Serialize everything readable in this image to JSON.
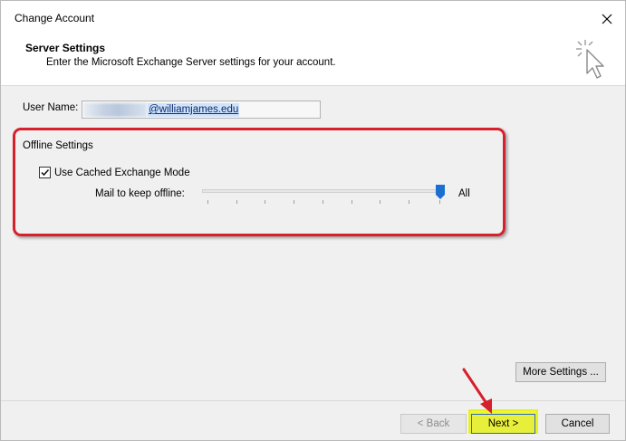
{
  "window": {
    "title": "Change Account"
  },
  "header": {
    "title": "Server Settings",
    "subtitle": "Enter the Microsoft Exchange Server settings for your account."
  },
  "form": {
    "user_name_label": "User Name:",
    "user_name_value": "@williamjames.edu",
    "offline_group_label": "Offline Settings",
    "cached_mode_label": "Use Cached Exchange Mode",
    "cached_mode_checked": true,
    "mail_offline_label": "Mail to keep offline:",
    "mail_offline_value": "All",
    "mail_offline_level": 1.0
  },
  "buttons": {
    "more_settings": "More Settings ...",
    "back": "< Back",
    "next": "Next >",
    "cancel": "Cancel"
  },
  "colors": {
    "annotation_red": "#d6202b",
    "highlight_yellow": "#eef535",
    "slider_thumb": "#1a6fd0"
  },
  "icons": {
    "close": "close-icon",
    "wizard": "wizard-cursor-icon",
    "check": "checkmark-icon",
    "arrow": "annotation-arrow-icon"
  }
}
